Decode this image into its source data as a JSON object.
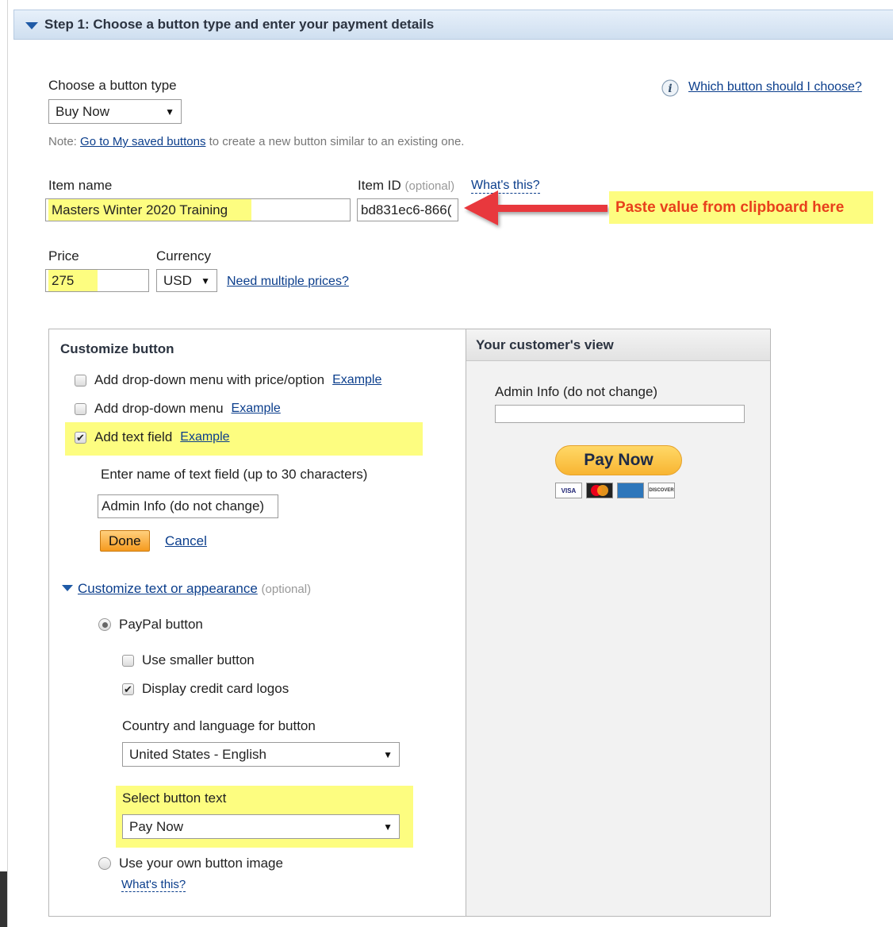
{
  "step_header": {
    "title": "Step 1: Choose a button type and enter your payment details"
  },
  "button_type": {
    "label": "Choose a button type",
    "selected": "Buy Now",
    "help_link": "Which button should I choose?",
    "note_prefix": "Note: ",
    "note_link": "Go to My saved buttons",
    "note_suffix": " to create a new button similar to an existing one."
  },
  "item": {
    "name_label": "Item name",
    "name_value": "Masters Winter 2020 Training",
    "id_label": "Item ID",
    "id_optional": "(optional)",
    "id_help": "What's this?",
    "id_value": "bd831ec6-866("
  },
  "annotation": {
    "callout_text": "Paste value from clipboard here",
    "arrow_color": "#e8383d"
  },
  "pricing": {
    "price_label": "Price",
    "price_value": "275",
    "currency_label": "Currency",
    "currency_value": "USD",
    "multi_link": "Need multiple prices?"
  },
  "customize": {
    "title": "Customize button",
    "options": [
      {
        "label": "Add drop-down menu with price/option",
        "example": "Example",
        "checked": false
      },
      {
        "label": "Add drop-down menu",
        "example": "Example",
        "checked": false
      },
      {
        "label": "Add text field",
        "example": "Example",
        "checked": true
      }
    ],
    "text_field_prompt": "Enter name of text field (up to 30 characters)",
    "text_field_value": "Admin Info (do not change)",
    "done_label": "Done",
    "cancel_label": "Cancel",
    "appearance_link": "Customize text or appearance",
    "appearance_optional": "(optional)",
    "paypal_button_label": "PayPal button",
    "smaller_label": "Use smaller button",
    "logos_label": "Display credit card logos",
    "country_label": "Country and language for button",
    "country_value": "United States - English",
    "button_text_label": "Select button text",
    "button_text_value": "Pay Now",
    "own_image_label": "Use your own button image",
    "own_image_help": "What's this?"
  },
  "preview": {
    "title": "Your customer's view",
    "field_label": "Admin Info (do not change)",
    "pay_button": "Pay Now",
    "cards": [
      "VISA",
      "MC",
      "AMEX",
      "DISCOVER"
    ]
  }
}
